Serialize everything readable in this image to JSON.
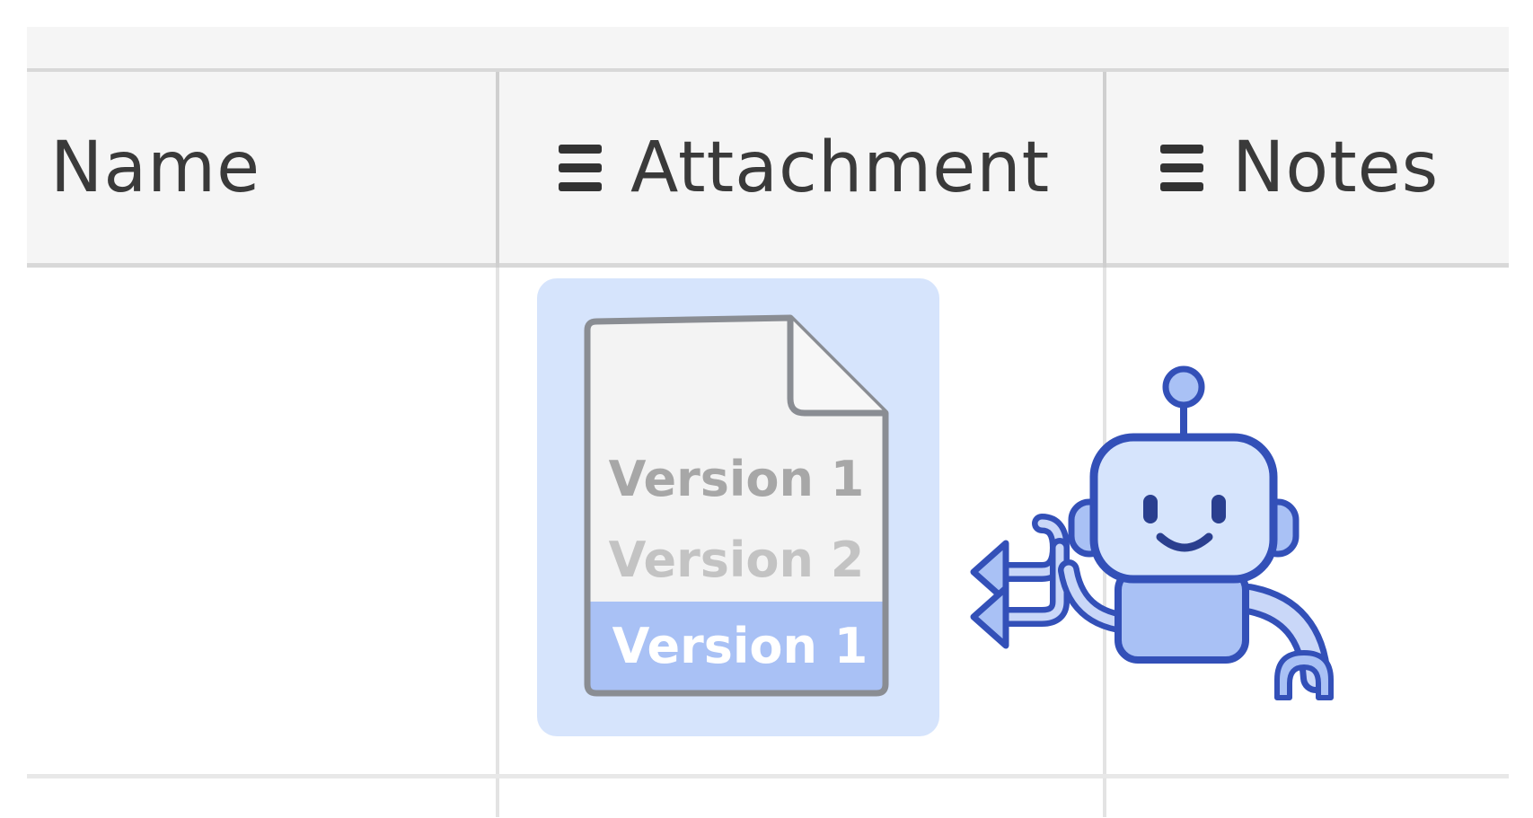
{
  "table": {
    "columns": [
      {
        "label": "Name",
        "icon": "none"
      },
      {
        "label": "Attachment",
        "icon": "lines-icon"
      },
      {
        "label": "Notes",
        "icon": "lines-icon"
      }
    ]
  },
  "attachment": {
    "versions": [
      "Version 1",
      "Version 2",
      "Version 1"
    ],
    "card_color": "#d6e4fc",
    "highlight_color": "#a9c1f5"
  },
  "robot": {
    "icon": "robot-icon",
    "arrow_icon": "undo-arrows-icon",
    "primary_color": "#3350b8",
    "fill_color": "#a9c1f5"
  }
}
